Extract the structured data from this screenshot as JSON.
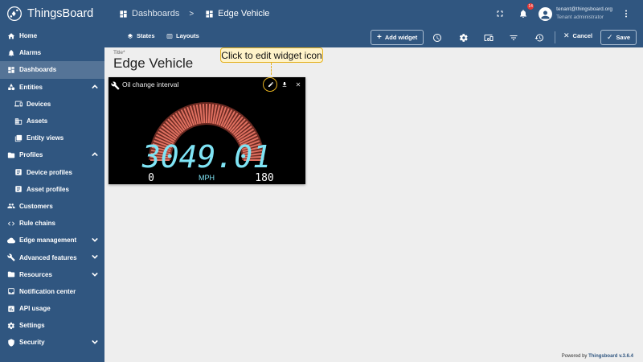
{
  "brand": {
    "name": "ThingsBoard"
  },
  "nav": {
    "home": "Home",
    "alarms": "Alarms",
    "dashboards": "Dashboards",
    "entities": "Entities",
    "devices": "Devices",
    "assets": "Assets",
    "entity_views": "Entity views",
    "profiles": "Profiles",
    "device_profiles": "Device profiles",
    "asset_profiles": "Asset profiles",
    "customers": "Customers",
    "rule_chains": "Rule chains",
    "edge_management": "Edge management",
    "advanced_features": "Advanced features",
    "resources": "Resources",
    "notification_center": "Notification center",
    "api_usage": "API usage",
    "settings": "Settings",
    "security": "Security"
  },
  "header": {
    "breadcrumb_root": "Dashboards",
    "breadcrumb_sep": ">",
    "breadcrumb_current": "Edge Vehicle",
    "notification_count": "14",
    "user_email": "tenant@thingsboard.org",
    "user_role": "Tenant administrator"
  },
  "toolbar": {
    "states_label": "States",
    "layouts_label": "Layouts",
    "add_widget_label": "Add widget",
    "cancel_label": "Cancel",
    "save_label": "Save"
  },
  "dashboard": {
    "title_label": "Title*",
    "title_value": "Edge Vehicle"
  },
  "callout": {
    "text": "Click to edit widget icon"
  },
  "widget": {
    "title": "Oil change interval",
    "gauge_value": "3049.01",
    "min_label": "0",
    "max_label": "180",
    "unit_label": "MPH",
    "value_color": "#7fe4f5",
    "arc_color": "#e07060"
  },
  "footer": {
    "prefix": "Powered by",
    "brand_version": "Thingsboard v.3.6.4"
  },
  "colors": {
    "primary": "#305680",
    "callout_border": "#e4b11f",
    "callout_bg": "#fff3c9"
  }
}
